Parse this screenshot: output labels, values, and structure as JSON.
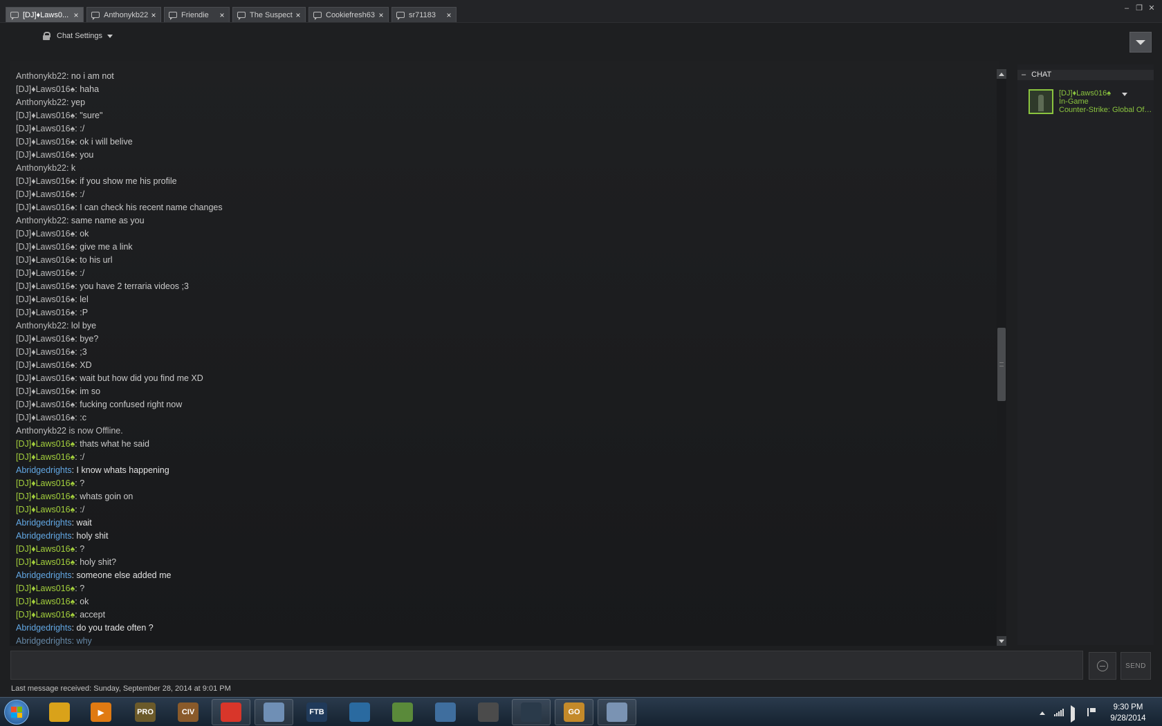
{
  "tabs": [
    {
      "label": "[DJ]♦Laws0...",
      "active": true
    },
    {
      "label": "Anthonykb22",
      "active": false
    },
    {
      "label": "Friendie",
      "active": false
    },
    {
      "label": "The Suspect",
      "active": false
    },
    {
      "label": "Cookiefresh63",
      "active": false
    },
    {
      "label": "sr71183",
      "active": false
    }
  ],
  "tab_close_glyph": "×",
  "window_controls": {
    "minimize": "–",
    "restore": "❐",
    "close": "✕"
  },
  "settings": {
    "label": "Chat Settings"
  },
  "messages": [
    {
      "who": "Anthonykb22",
      "text": ": no i am not",
      "kind": "other"
    },
    {
      "who": "[DJ]♦Laws016♠",
      "text": ": haha",
      "kind": "other"
    },
    {
      "who": "Anthonykb22",
      "text": ": yep",
      "kind": "other"
    },
    {
      "who": "[DJ]♦Laws016♠",
      "text": ": \"sure\"",
      "kind": "other"
    },
    {
      "who": "[DJ]♦Laws016♠",
      "text": ": :/",
      "kind": "other"
    },
    {
      "who": "[DJ]♦Laws016♠",
      "text": ": ok i will belive",
      "kind": "other"
    },
    {
      "who": "[DJ]♦Laws016♠",
      "text": ": you",
      "kind": "other"
    },
    {
      "who": "Anthonykb22",
      "text": ": k",
      "kind": "other"
    },
    {
      "who": "[DJ]♦Laws016♠",
      "text": ": if you show me his profile",
      "kind": "other"
    },
    {
      "who": "[DJ]♦Laws016♠",
      "text": ": :/",
      "kind": "other"
    },
    {
      "who": "[DJ]♦Laws016♠",
      "text": ": I can check his recent name changes",
      "kind": "other"
    },
    {
      "who": "Anthonykb22",
      "text": ": same name as you",
      "kind": "other"
    },
    {
      "who": "[DJ]♦Laws016♠",
      "text": ": ok",
      "kind": "other"
    },
    {
      "who": "[DJ]♦Laws016♠",
      "text": ": give me a link",
      "kind": "other"
    },
    {
      "who": "[DJ]♦Laws016♠",
      "text": ": to his url",
      "kind": "other"
    },
    {
      "who": "[DJ]♦Laws016♠",
      "text": ": :/",
      "kind": "other"
    },
    {
      "who": "[DJ]♦Laws016♠",
      "text": ": you have 2 terraria videos ;3",
      "kind": "other"
    },
    {
      "who": "[DJ]♦Laws016♠",
      "text": ": lel",
      "kind": "other"
    },
    {
      "who": "[DJ]♦Laws016♠",
      "text": ": :P",
      "kind": "other"
    },
    {
      "who": "Anthonykb22",
      "text": ": lol bye",
      "kind": "other"
    },
    {
      "who": "[DJ]♦Laws016♠",
      "text": ": bye?",
      "kind": "other"
    },
    {
      "who": "[DJ]♦Laws016♠",
      "text": ": ;3",
      "kind": "other"
    },
    {
      "who": "[DJ]♦Laws016♠",
      "text": ": XD",
      "kind": "other"
    },
    {
      "who": "[DJ]♦Laws016♠",
      "text": ": wait but how did you find me XD",
      "kind": "other"
    },
    {
      "who": "[DJ]♦Laws016♠",
      "text": ": im so",
      "kind": "other"
    },
    {
      "who": "[DJ]♦Laws016♠",
      "text": ": fucking confused right now",
      "kind": "other"
    },
    {
      "who": "[DJ]♦Laws016♠",
      "text": ": :c",
      "kind": "other"
    },
    {
      "who": "",
      "text": "Anthonykb22 is now Offline.",
      "kind": "sys"
    },
    {
      "who": "[DJ]♦Laws016♠",
      "text": ": thats what he said",
      "kind": "me"
    },
    {
      "who": "[DJ]♦Laws016♠",
      "text": ": :/",
      "kind": "me"
    },
    {
      "who": "Abridgedrights",
      "text": ": I know whats happening",
      "kind": "abr"
    },
    {
      "who": "[DJ]♦Laws016♠",
      "text": ": ?",
      "kind": "me"
    },
    {
      "who": "[DJ]♦Laws016♠",
      "text": ": whats goin on",
      "kind": "me"
    },
    {
      "who": "[DJ]♦Laws016♠",
      "text": ": :/",
      "kind": "me"
    },
    {
      "who": "Abridgedrights",
      "text": ": wait",
      "kind": "abr"
    },
    {
      "who": "Abridgedrights",
      "text": ": holy shit",
      "kind": "abr"
    },
    {
      "who": "[DJ]♦Laws016♠",
      "text": ": ?",
      "kind": "me"
    },
    {
      "who": "[DJ]♦Laws016♠",
      "text": ": holy shit?",
      "kind": "me"
    },
    {
      "who": "Abridgedrights",
      "text": ": someone else added me",
      "kind": "abr"
    },
    {
      "who": "[DJ]♦Laws016♠",
      "text": ": ?",
      "kind": "me"
    },
    {
      "who": "[DJ]♦Laws016♠",
      "text": ": ok",
      "kind": "me"
    },
    {
      "who": "[DJ]♦Laws016♠",
      "text": ": accept",
      "kind": "me"
    },
    {
      "who": "Abridgedrights",
      "text": ": do you trade often ?",
      "kind": "abr"
    },
    {
      "who": "Abridgedrights",
      "text": ": why",
      "kind": "dim"
    }
  ],
  "friends_panel": {
    "header": "CHAT",
    "friend": {
      "name": "[DJ]♦Laws016♠",
      "status": "In-Game",
      "game": "Counter-Strike: Global Offensive"
    }
  },
  "composer": {
    "send_label": "SEND",
    "last_message": "Last message received: Sunday, September 28, 2014 at 9:01 PM"
  },
  "taskbar": {
    "apps": [
      {
        "name": "explorer",
        "glyph": "",
        "color": "#d9a21a"
      },
      {
        "name": "media-player",
        "glyph": "▶",
        "color": "#e07a12"
      },
      {
        "name": "pro-app",
        "glyph": "PRO",
        "color": "#6b5a2a"
      },
      {
        "name": "civ",
        "glyph": "CIV",
        "color": "#8a5a2a"
      },
      {
        "name": "chrome",
        "glyph": "",
        "color": "#d8362a"
      },
      {
        "name": "notepad",
        "glyph": "",
        "color": "#6f8fb5"
      },
      {
        "name": "ftb",
        "glyph": "FTB",
        "color": "#203a5a"
      },
      {
        "name": "tree-app",
        "glyph": "",
        "color": "#2a6aa0"
      },
      {
        "name": "minecraft",
        "glyph": "",
        "color": "#5a8a3a"
      },
      {
        "name": "paint",
        "glyph": "",
        "color": "#3f6e9e"
      },
      {
        "name": "movie-maker",
        "glyph": "",
        "color": "#4b4b4b"
      },
      {
        "name": "steam",
        "glyph": "",
        "color": "#2a3a4a"
      },
      {
        "name": "csgo",
        "glyph": "GO",
        "color": "#c48a2a"
      },
      {
        "name": "calculator",
        "glyph": "",
        "color": "#7a93b3"
      }
    ],
    "time": "9:30 PM",
    "date": "9/28/2014"
  }
}
